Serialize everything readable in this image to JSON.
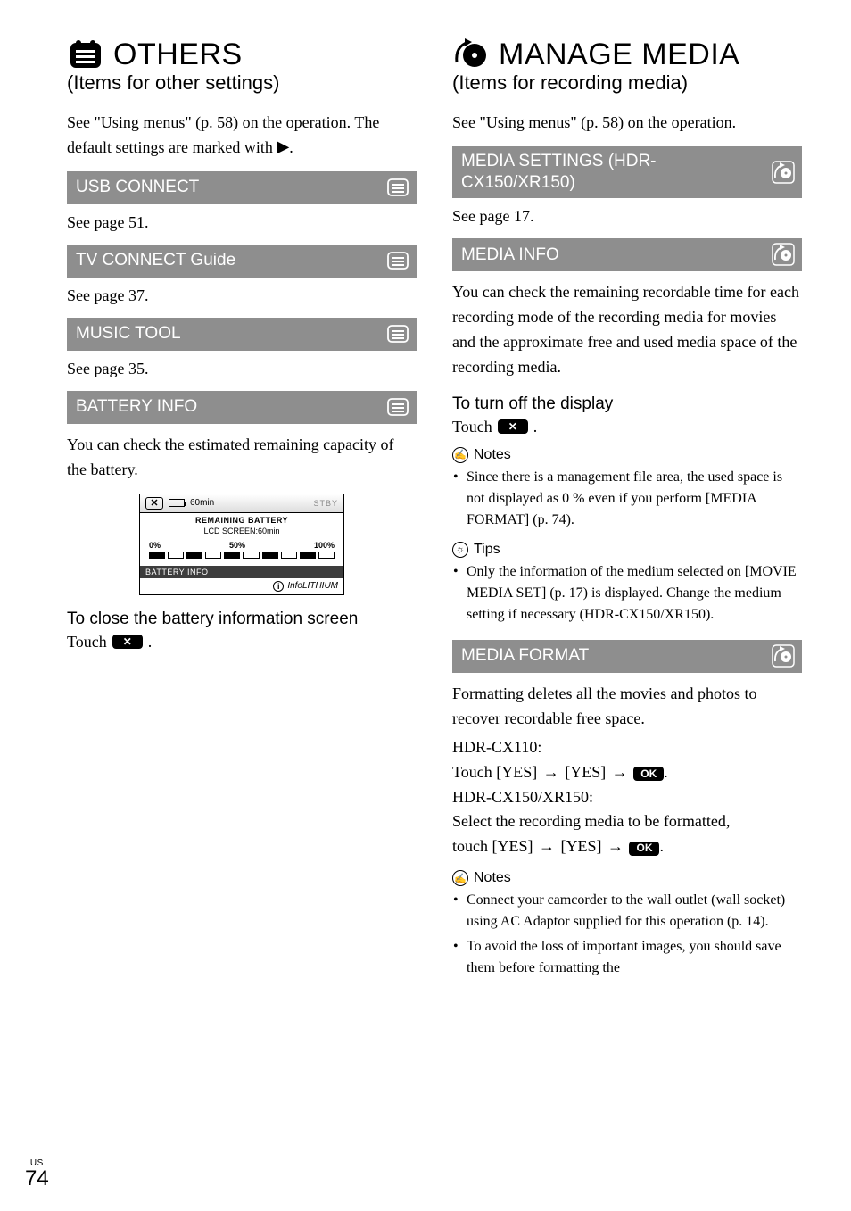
{
  "left": {
    "heading": "OTHERS",
    "sub": "(Items for other settings)",
    "intro1": "See \"Using menus\" (p. 58) on the operation.",
    "intro2_a": "The default settings are marked with ",
    "intro2_b": ".",
    "items": {
      "usb": {
        "title": "USB CONNECT",
        "see": "See page 51."
      },
      "tv": {
        "title": "TV CONNECT Guide",
        "see": "See page 37."
      },
      "music": {
        "title": "MUSIC TOOL",
        "see": "See page 35."
      },
      "batt": {
        "title": "BATTERY INFO"
      }
    },
    "batt_desc": "You can check the estimated remaining capacity of the battery.",
    "batt_screen": {
      "time": "60min",
      "stby": "STBY",
      "title": "REMAINING BATTERY",
      "sub": "LCD SCREEN:60min",
      "scale": [
        "0%",
        "50%",
        "100%"
      ],
      "label": "BATTERY INFO",
      "brand": "InfoLITHIUM"
    },
    "batt_close_h": "To close the battery information screen",
    "touch": "Touch",
    "period": "."
  },
  "right": {
    "heading": "MANAGE MEDIA",
    "sub": "(Items for recording media)",
    "intro": "See \"Using menus\" (p. 58) on the operation.",
    "items": {
      "settings": {
        "title": "MEDIA SETTINGS (HDR-CX150/XR150)",
        "see": "See page 17."
      },
      "info": {
        "title": "MEDIA INFO"
      },
      "format": {
        "title": "MEDIA FORMAT"
      }
    },
    "info_desc": "You can check the remaining recordable time for each recording mode of the recording media for movies and the approximate free and used media space of the recording media.",
    "turn_off_h": "To turn off the display",
    "touch": "Touch",
    "period": ".",
    "notes_label": "Notes",
    "tips_label": "Tips",
    "info_notes": [
      "Since there is a management file area, the used space is not displayed as 0 % even if you perform [MEDIA FORMAT] (p. 74)."
    ],
    "info_tips": [
      "Only the information of the medium selected on [MOVIE MEDIA SET] (p. 17) is displayed. Change the medium setting if necessary (HDR-CX150/XR150)."
    ],
    "format_desc": "Formatting deletes all the movies and photos to recover recordable free space.",
    "m1": "HDR-CX110:",
    "m1_flow_a": "Touch [YES]",
    "m1_flow_b": "[YES]",
    "m2": "HDR-CX150/XR150:",
    "m2_line": "Select the recording media to be formatted,",
    "m2_flow_a": "touch [YES]",
    "m2_flow_b": "[YES]",
    "ok": "OK",
    "format_notes": [
      "Connect your camcorder to the wall outlet (wall socket) using AC Adaptor supplied for this operation (p. 14).",
      "To avoid the loss of important images, you should save them before formatting the"
    ]
  },
  "footer": {
    "region": "US",
    "page": "74"
  }
}
